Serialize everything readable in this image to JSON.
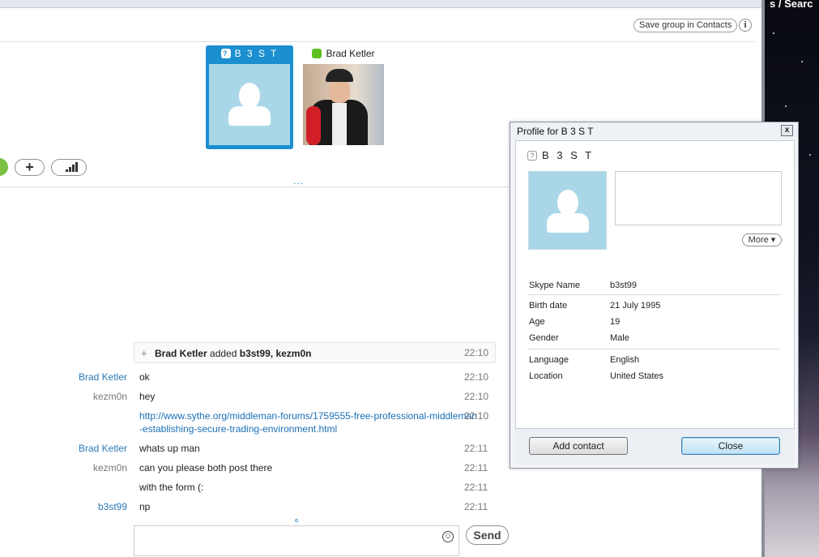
{
  "header": {
    "save_group_label": "Save group in Contacts",
    "info_label": "i"
  },
  "wallpaper": {
    "title": "s / Searc"
  },
  "participants": [
    {
      "name": "B 3 S T",
      "status": "unknown",
      "avatar": "default-silhouette",
      "selected": true
    },
    {
      "name": "Brad Ketler",
      "status": "online",
      "avatar": "photo"
    }
  ],
  "toolbar": {
    "add_label": "+",
    "signal_icon": "signal-bars-icon",
    "dots_handle": "..."
  },
  "chat": {
    "event": {
      "actor": "Brad Ketler",
      "verb": "added",
      "targets": "b3st99, kezm0n",
      "time": "22:10"
    },
    "messages": [
      {
        "sender": "Brad Ketler",
        "text": "ok",
        "time": "22:10"
      },
      {
        "sender": "kezm0n",
        "text": "hey",
        "time": "22:10"
      },
      {
        "sender": "",
        "text_line1": "http://www.sythe.org/middleman-forums/1759555-free-professional-middleman",
        "text_line2": "-establishing-secure-trading-environment.html",
        "time": "22:10"
      },
      {
        "sender": "Brad Ketler",
        "text": "whats up man",
        "time": "22:11"
      },
      {
        "sender": "kezm0n",
        "text": "can you please both post there",
        "time": "22:11"
      },
      {
        "sender": "",
        "text": "with the form (:",
        "time": "22:11"
      },
      {
        "sender": "b3st99",
        "text": "np",
        "time": "22:11"
      }
    ],
    "input_placeholder": "",
    "emoji_icon": "smiley-icon",
    "send_label": "Send"
  },
  "profile": {
    "window_title": "Profile for B 3 S T",
    "close_x": "x",
    "display_name": "B 3 S T",
    "more_label": "More",
    "fields": [
      {
        "label": "Skype Name",
        "value": "b3st99"
      },
      {
        "label": "Birth date",
        "value": "21 July 1995"
      },
      {
        "label": "Age",
        "value": "19"
      },
      {
        "label": "Gender",
        "value": "Male"
      },
      {
        "label": "Language",
        "value": "English"
      },
      {
        "label": "Location",
        "value": "United States"
      }
    ],
    "add_contact_label": "Add contact",
    "close_label": "Close"
  },
  "colors": {
    "accent_blue": "#1b8fd0",
    "online_green": "#5ec020",
    "avatar_bg": "#a9d7e8",
    "sender_blue": "#2b79b5"
  }
}
